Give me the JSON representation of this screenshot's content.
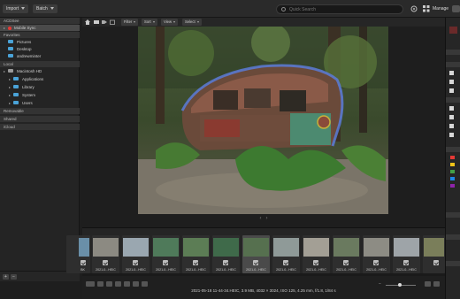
{
  "toolbar": {
    "import_label": "Import",
    "batch_label": "Batch",
    "search_placeholder": "Quick Search",
    "manage_label": "Manage"
  },
  "toolbar2": {
    "filter_label": "Filter",
    "sort_label": "Sort",
    "view_label": "View",
    "select_label": "Select"
  },
  "sidebar": {
    "sections": [
      {
        "label": "ACDSee",
        "items": [
          {
            "label": "Mobile Sync"
          }
        ]
      },
      {
        "label": "Favorites",
        "items": [
          {
            "label": "Pictures"
          },
          {
            "label": "Desktop"
          },
          {
            "label": "andrewminter"
          }
        ]
      },
      {
        "label": "Local",
        "items": [
          {
            "label": "Macintosh HD"
          },
          {
            "label": "Applications"
          },
          {
            "label": "Library"
          },
          {
            "label": "System"
          },
          {
            "label": "Users"
          }
        ]
      },
      {
        "label": "Removable"
      },
      {
        "label": "Shared"
      },
      {
        "label": "iCloud"
      }
    ]
  },
  "filmstrip": {
    "thumbs": [
      {
        "label": "BK",
        "color": "#6a8fa8"
      },
      {
        "label": "2021-0...HEIC",
        "color": "#8c8a82"
      },
      {
        "label": "2021-0...HEIC",
        "color": "#9aa7b0"
      },
      {
        "label": "2021-0...HEIC",
        "color": "#4f7a5a"
      },
      {
        "label": "2021-0...HEIC",
        "color": "#5c7d55"
      },
      {
        "label": "2021-0...HEIC",
        "color": "#3f6a4a"
      },
      {
        "label": "2021-0...HEIC",
        "color": "#56704f"
      },
      {
        "label": "2021-0...HEIC",
        "color": "#8f9a98"
      },
      {
        "label": "2021-0...HEIC",
        "color": "#a39f95"
      },
      {
        "label": "2021-0...HEIC",
        "color": "#6a7a5f"
      },
      {
        "label": "2021-0...HEIC",
        "color": "#8d8c84"
      },
      {
        "label": "2021-0...HEIC",
        "color": "#9ea4a8"
      },
      {
        "label": "",
        "color": "#7a7e5a"
      }
    ]
  },
  "status": {
    "text": "2021-05-18 11-44-34.HEIC, 3.9 MB, 4032 × 3024, ISO 125, 4.25 mm, f/1.8, 1/84 s"
  },
  "colors": {
    "accent": "#4aa3d8",
    "selected": "#4a4a4a"
  }
}
